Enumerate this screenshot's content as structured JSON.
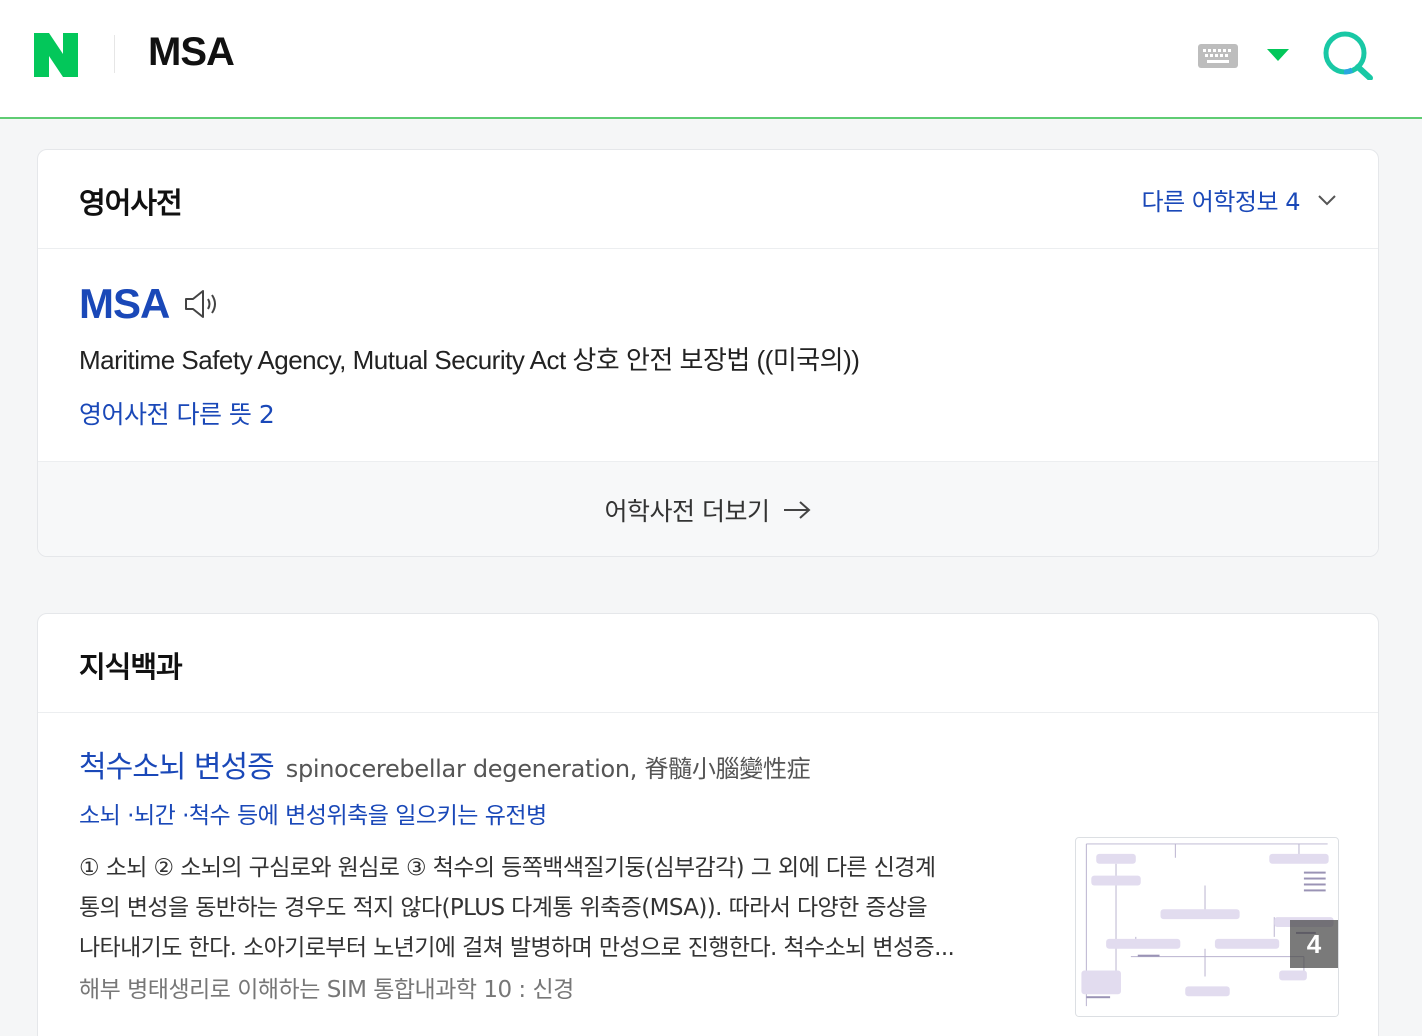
{
  "header": {
    "query": "MSA",
    "logo_letter": "N",
    "brand_color": "#03c75a",
    "icons": [
      "naver-logo-icon",
      "keyboard-icon",
      "caret-down-icon",
      "search-icon"
    ]
  },
  "dictionary": {
    "title": "영어사전",
    "other_info_label": "다른 어학정보 4",
    "word": "MSA",
    "meaning": "Maritime Safety Agency, Mutual Security Act 상호 안전 보장법 ((미국의))",
    "other_meanings_label": "영어사전 다른 뜻 2",
    "more_label": "어학사전 더보기"
  },
  "knowledge": {
    "title": "지식백과",
    "entry_title": "척수소뇌 변성증",
    "entry_subtitle": "spinocerebellar degeneration, 脊髓小腦變性症",
    "entry_summary": "소뇌 ·뇌간 ·척수 등에 변성위축을 일으키는 유전병",
    "desc_line1": "① 소뇌 ② 소뇌의 구심로와 원심로 ③ 척수의 등쪽백색질기둥(심부감각) 그 외에 다른 신경계",
    "desc_line2": "통의 변성을 동반하는 경우도 적지 않다(PLUS 다계통 위축증(MSA)). 따라서 다양한 증상을",
    "desc_line3": "나타내기도 한다. 소아기로부터 노년기에 걸쳐 발병하며 만성으로 진행한다. 척수소뇌 변성증...",
    "source": "해부 병태생리로 이해하는 SIM 통합내과학 10 : 신경",
    "thumb_count": "4"
  },
  "colors": {
    "link_blue": "#1a48b8",
    "header_border": "#5fcc73"
  }
}
